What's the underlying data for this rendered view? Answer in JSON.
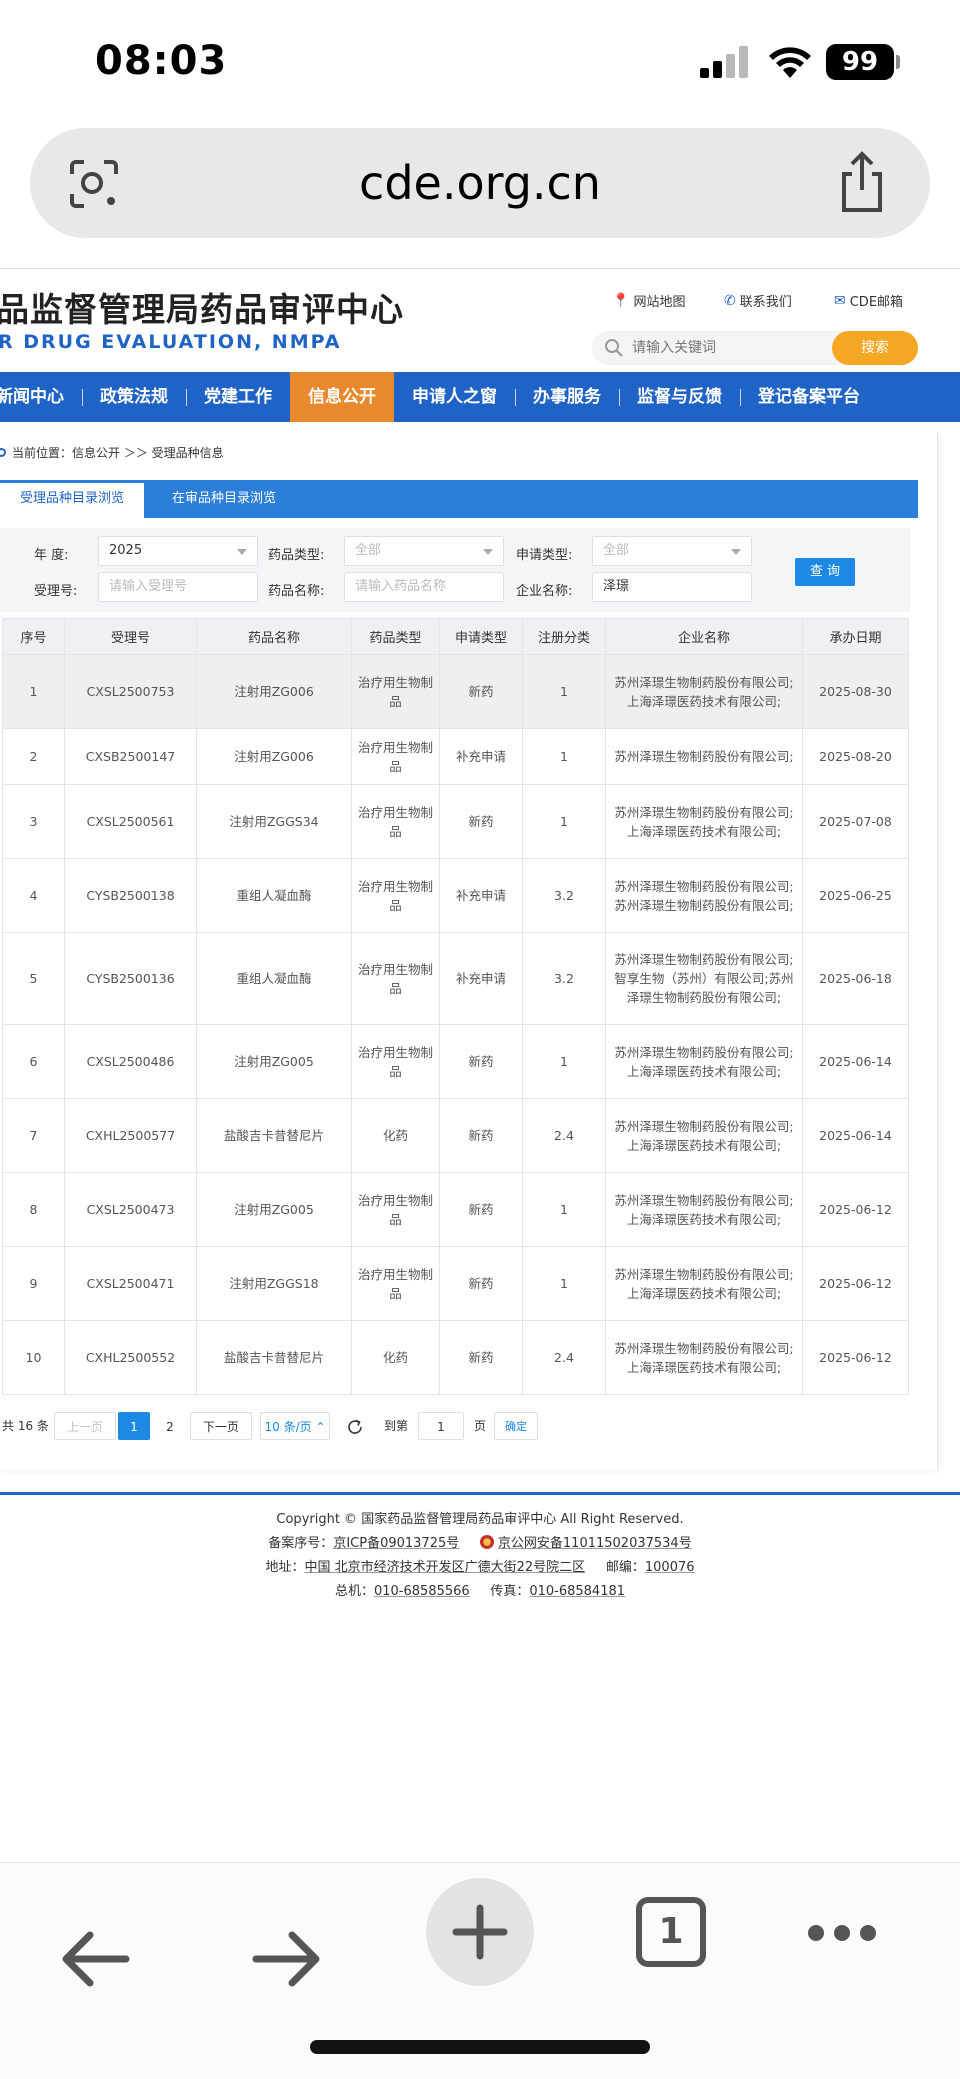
{
  "status_bar": {
    "time": "08:03",
    "battery": "99"
  },
  "browser": {
    "url": "cde.org.cn"
  },
  "site": {
    "title": "品监督管理局药品审评中心",
    "subtitle": "R DRUG EVALUATION, NMPA",
    "links": [
      "网站地图",
      "联系我们",
      "CDE邮箱"
    ],
    "search_placeholder": "请输入关键词",
    "search_button": "搜索"
  },
  "nav": [
    "新闻中心",
    "政策法规",
    "党建工作",
    "信息公开",
    "申请人之窗",
    "办事服务",
    "监督与反馈",
    "登记备案平台"
  ],
  "breadcrumb": "当前位置：信息公开 ＞＞ 受理品种信息",
  "tabs": [
    "受理品种目录浏览",
    "在审品种目录浏览"
  ],
  "filters": {
    "year_label": "年   度:",
    "year_value": "2025",
    "drug_type_label": "药品类型:",
    "drug_type_value": "全部",
    "apply_type_label": "申请类型:",
    "apply_type_value": "全部",
    "accept_no_label": "受理号:",
    "accept_no_placeholder": "请输入受理号",
    "drug_name_label": "药品名称:",
    "drug_name_placeholder": "请输入药品名称",
    "company_label": "企业名称:",
    "company_value": "泽璟",
    "query_button": "查 询"
  },
  "table": {
    "headers": [
      "序号",
      "受理号",
      "药品名称",
      "药品类型",
      "申请类型",
      "注册分类",
      "企业名称",
      "承办日期"
    ],
    "rows": [
      [
        "1",
        "CXSL2500753",
        "注射用ZG006",
        "治疗用生物制品",
        "新药",
        "1",
        "苏州泽璟生物制药股份有限公司;上海泽璟医药技术有限公司;",
        "2025-08-30"
      ],
      [
        "2",
        "CXSB2500147",
        "注射用ZG006",
        "治疗用生物制品",
        "补充申请",
        "1",
        "苏州泽璟生物制药股份有限公司;",
        "2025-08-20"
      ],
      [
        "3",
        "CXSL2500561",
        "注射用ZGGS34",
        "治疗用生物制品",
        "新药",
        "1",
        "苏州泽璟生物制药股份有限公司;上海泽璟医药技术有限公司;",
        "2025-07-08"
      ],
      [
        "4",
        "CYSB2500138",
        "重组人凝血酶",
        "治疗用生物制品",
        "补充申请",
        "3.2",
        "苏州泽璟生物制药股份有限公司;苏州泽璟生物制药股份有限公司;",
        "2025-06-25"
      ],
      [
        "5",
        "CYSB2500136",
        "重组人凝血酶",
        "治疗用生物制品",
        "补充申请",
        "3.2",
        "苏州泽璟生物制药股份有限公司;智享生物（苏州）有限公司;苏州泽璟生物制药股份有限公司;",
        "2025-06-18"
      ],
      [
        "6",
        "CXSL2500486",
        "注射用ZG005",
        "治疗用生物制品",
        "新药",
        "1",
        "苏州泽璟生物制药股份有限公司;上海泽璟医药技术有限公司;",
        "2025-06-14"
      ],
      [
        "7",
        "CXHL2500577",
        "盐酸吉卡昔替尼片",
        "化药",
        "新药",
        "2.4",
        "苏州泽璟生物制药股份有限公司;上海泽璟医药技术有限公司;",
        "2025-06-14"
      ],
      [
        "8",
        "CXSL2500473",
        "注射用ZG005",
        "治疗用生物制品",
        "新药",
        "1",
        "苏州泽璟生物制药股份有限公司;上海泽璟医药技术有限公司;",
        "2025-06-12"
      ],
      [
        "9",
        "CXSL2500471",
        "注射用ZGGS18",
        "治疗用生物制品",
        "新药",
        "1",
        "苏州泽璟生物制药股份有限公司;上海泽璟医药技术有限公司;",
        "2025-06-12"
      ],
      [
        "10",
        "CXHL2500552",
        "盐酸吉卡昔替尼片",
        "化药",
        "新药",
        "2.4",
        "苏州泽璟生物制药股份有限公司;上海泽璟医药技术有限公司;",
        "2025-06-12"
      ]
    ]
  },
  "pagination": {
    "total": "共 16 条",
    "prev": "上一页",
    "page1": "1",
    "page2": "2",
    "next": "下一页",
    "page_size": "10 条/页",
    "goto_label": "到第",
    "goto_value": "1",
    "page_unit": "页",
    "confirm": "确定"
  },
  "footer": {
    "copyright": "Copyright © 国家药品监督管理局药品审评中心   All Right Reserved.",
    "icp_label": "备案序号：",
    "icp": "京ICP备09013725号",
    "police": "京公网安备11011502037534号",
    "address_label": "地址：",
    "address": "中国 北京市经济技术开发区广德大街22号院二区",
    "zip_label": "邮编：",
    "zip": "100076",
    "phone_label": "总机：",
    "phone": "010-68585566",
    "fax_label": "传真：",
    "fax": "010-68584181"
  },
  "toolbar": {
    "tab_count": "1"
  }
}
